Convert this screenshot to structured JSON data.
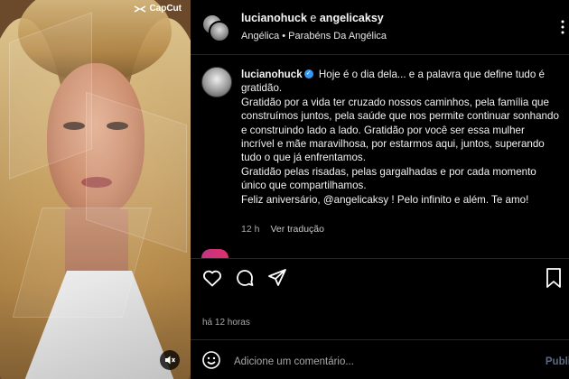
{
  "media": {
    "watermark": "CapCut",
    "mute_icon": "volume-muted-icon"
  },
  "header": {
    "user1": "lucianohuck",
    "joiner": "e",
    "user2": "angelicaksy",
    "subtitle": "Angélica • Parabéns Da Angélica"
  },
  "caption": {
    "username": "lucianohuck",
    "lines": [
      "Hoje é o dia dela... e a palavra que define tudo é gratidão.",
      "Gratidão por a vida ter cruzado nossos caminhos, pela família que construímos juntos, pela saúde que nos permite continuar sonhando e construindo lado a lado. Gratidão por você ser essa mulher incrível e mãe maravilhosa, por estarmos aqui, juntos, superando tudo o que já enfrentamos.",
      "Gratidão pelas risadas, pelas gargalhadas e por cada momento único que compartilhamos.",
      "Feliz aniversário, @angelicaksy ! Pelo infinito e além. Te amo!"
    ],
    "age": "12 h",
    "see_translation": "Ver tradução"
  },
  "footer": {
    "timestamp": "há 12 horas",
    "comment_placeholder": "Adicione um comentário...",
    "publish_label": "Publi"
  },
  "colors": {
    "background": "#000000",
    "verified": "#3897f0",
    "muted_text": "#a8a8a8"
  }
}
